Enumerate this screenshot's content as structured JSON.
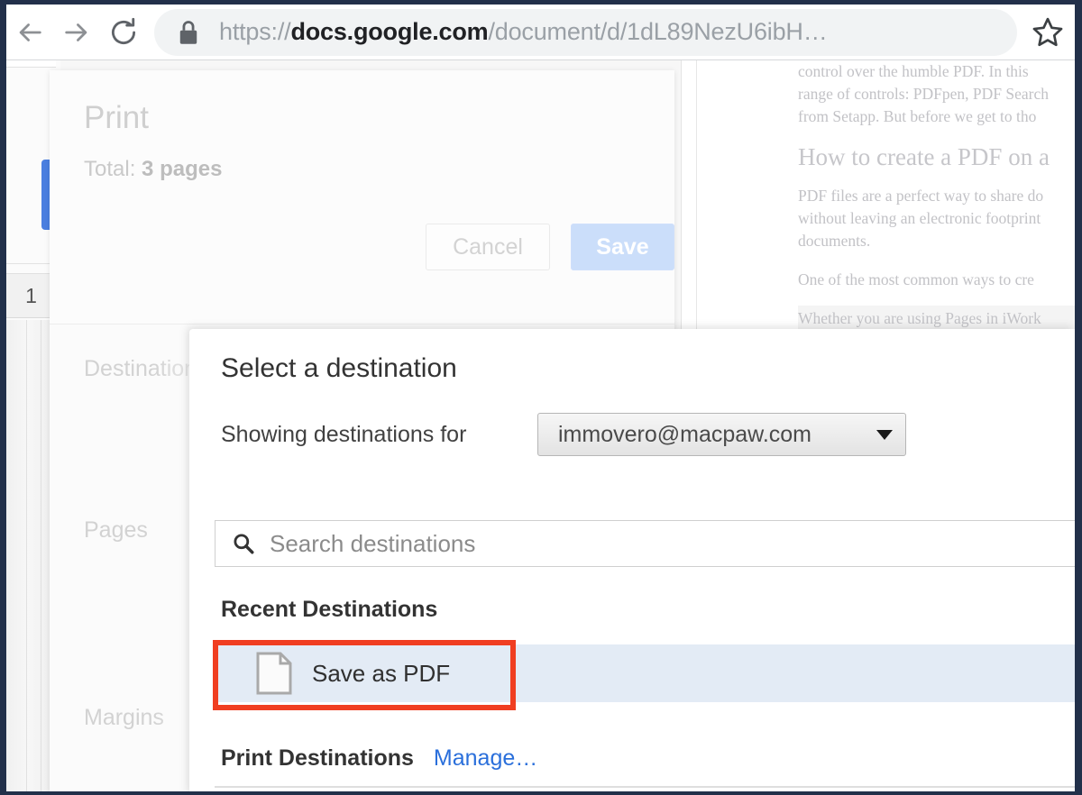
{
  "browser": {
    "back_icon": "back-arrow-icon",
    "forward_icon": "forward-arrow-icon",
    "reload_icon": "reload-icon",
    "lock_icon": "lock-icon",
    "star_icon": "star-icon",
    "url_scheme": "https://",
    "url_host": "docs.google.com",
    "url_path": "/document/d/1dL89NezU6ibH…"
  },
  "document_preview": {
    "lines": [
      "control over the humble PDF. In this",
      "range of controls: PDFpen, PDF Search",
      "from Setapp. But before we get to tho"
    ],
    "heading": "How to create a PDF on a",
    "paragraph_lines": [
      "PDF files are a perfect way to share do",
      "without leaving an electronic footprint",
      "documents."
    ],
    "line_common": "One of the most common ways to cre",
    "line_shaded": "Whether you are using Pages in iWork"
  },
  "print_dialog": {
    "title": "Print",
    "total_label": "Total:",
    "total_value": "3 pages",
    "cancel_label": "Cancel",
    "save_label": "Save",
    "fields": {
      "destination": "Destination",
      "pages": "Pages",
      "margins": "Margins"
    },
    "page_number": "1"
  },
  "destination_modal": {
    "title": "Select a destination",
    "showing_label": "Showing destinations for",
    "account": "immovero@macpaw.com",
    "account_caret_icon": "chevron-down-icon",
    "search": {
      "icon": "search-icon",
      "placeholder": "Search destinations",
      "value": ""
    },
    "recent_heading": "Recent Destinations",
    "recent_items": [
      {
        "icon": "document-icon",
        "label": "Save as PDF",
        "selected": true
      }
    ],
    "print_heading": "Print Destinations",
    "manage_link": "Manage…"
  },
  "annotation": {
    "type": "highlight-box",
    "target": "Save as PDF",
    "color": "#f03e21"
  },
  "colors": {
    "frame": "#22304a",
    "accent_blue": "#4a7fe0",
    "link_blue": "#2a6fdb",
    "row_selected": "#e3ebf5",
    "save_button": "#cbdefa",
    "annotation_red": "#f03e21"
  }
}
